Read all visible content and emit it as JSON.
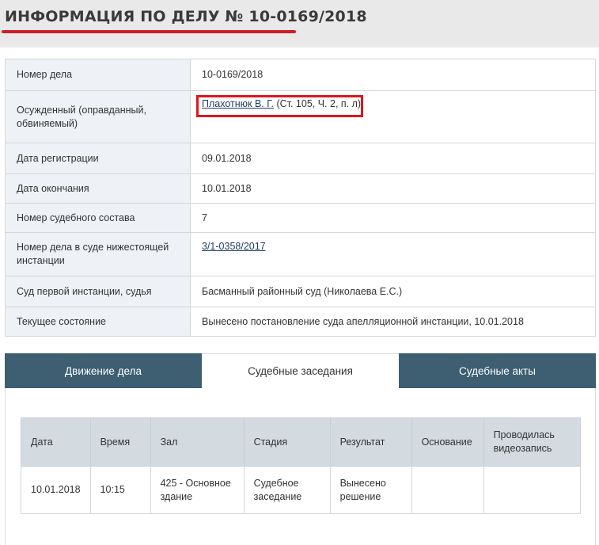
{
  "page": {
    "title": "ИНФОРМАЦИЯ ПО ДЕЛУ № 10-0169/2018"
  },
  "case_info": {
    "rows": [
      {
        "label": "Номер дела",
        "value": "10-0169/2018"
      },
      {
        "label": "Осужденный (оправданный, обвиняемый)",
        "value_link": "Плахотнюк В. Г.",
        "value_suffix": " (Ст. 105, Ч. 2, п. л)"
      },
      {
        "label": "Дата регистрации",
        "value": "09.01.2018"
      },
      {
        "label": "Дата окончания",
        "value": "10.01.2018"
      },
      {
        "label": "Номер судебного состава",
        "value": "7"
      },
      {
        "label": "Номер дела в суде нижестоящей инстанции",
        "value_link": "3/1-0358/2017"
      },
      {
        "label": "Суд первой инстанции, судья",
        "value": "Басманный районный суд (Николаева Е.С.)"
      },
      {
        "label": "Текущее состояние",
        "value": "Вынесено постановление суда апелляционной инстанции, 10.01.2018"
      }
    ]
  },
  "tabs": [
    {
      "label": "Движение дела",
      "active": false
    },
    {
      "label": "Судебные заседания",
      "active": true
    },
    {
      "label": "Судебные акты",
      "active": false
    }
  ],
  "sessions": {
    "headers": [
      "Дата",
      "Время",
      "Зал",
      "Стадия",
      "Результат",
      "Основание",
      "Проводилась видеозапись"
    ],
    "rows": [
      [
        "10.01.2018",
        "10:15",
        "425 - Основное здание",
        "Судебное заседание",
        "Вынесено решение",
        "",
        ""
      ]
    ]
  },
  "colors": {
    "accent_red": "#d01d27",
    "highlight_red": "#e1141d",
    "tab_dark": "#3e5e72",
    "label_bg": "#eef1f5",
    "header_bg": "#e9e9e9",
    "table_header_bg": "#d3dbe1",
    "link": "#1e3d62"
  }
}
